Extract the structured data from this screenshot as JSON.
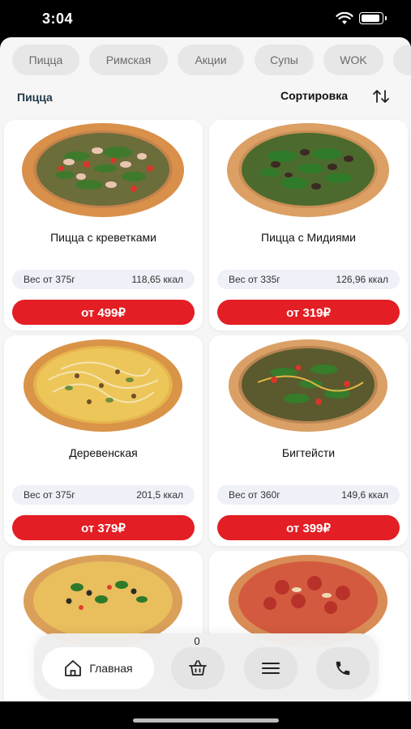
{
  "status_bar": {
    "time": "3:04"
  },
  "categories": [
    "Пицца",
    "Римская",
    "Акции",
    "Супы",
    "WOK"
  ],
  "section_title": "Пицца",
  "sort_label": "Сортировка",
  "products": [
    {
      "name": "Пицца с креветками",
      "weight": "Вес от 375г",
      "kcal": "118,65 ккал",
      "price": "от 499₽"
    },
    {
      "name": "Пицца с Мидиями",
      "weight": "Вес от 335г",
      "kcal": "126,96 ккал",
      "price": "от 319₽"
    },
    {
      "name": "Деревенская",
      "weight": "Вес от 375г",
      "kcal": "201,5 ккал",
      "price": "от 379₽"
    },
    {
      "name": "Бигтейсти",
      "weight": "Вес от 360г",
      "kcal": "149,6 ккал",
      "price": "от 399₽"
    }
  ],
  "nav": {
    "home_label": "Главная",
    "cart_count": "0"
  },
  "icons": {
    "home": "home-icon",
    "cart": "basket-icon",
    "menu": "menu-icon",
    "phone": "phone-icon",
    "sort": "sort-arrows-icon"
  },
  "colors": {
    "accent": "#e31e24",
    "title": "#1f3a48",
    "background": "#f6f6f6"
  }
}
